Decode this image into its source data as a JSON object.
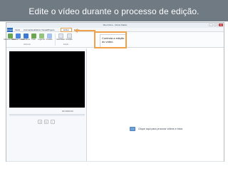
{
  "caption": "Edite o vídeo durante o processo de edição.",
  "window": {
    "title": "Meu Filme - Movie Maker",
    "controls": [
      "–",
      "□",
      "×"
    ]
  },
  "tabs": {
    "file": "Arquivo",
    "items": [
      "Início",
      "Animações",
      "Efeitos Visuais",
      "Projeto",
      "Exibir"
    ],
    "active_label": "Editar"
  },
  "ribbon": {
    "buttons": [
      {
        "label": "Adicionar vídeos",
        "icon": "add-video-icon",
        "color": "#6aa84f"
      },
      {
        "label": "Adicionar música",
        "icon": "add-music-icon",
        "color": "#4a86e8"
      },
      {
        "label": "Instantâneo",
        "icon": "snapshot-icon",
        "color": "#3c78d8"
      },
      {
        "label": "Título",
        "icon": "title-icon",
        "color": "#6aa84f"
      },
      {
        "label": "Legenda",
        "icon": "caption-icon",
        "color": "#93c47d"
      },
      {
        "label": "Créditos",
        "icon": "credits-icon",
        "color": "#a4c2f4"
      }
    ],
    "group_labels": [
      "Adicionar",
      "Edição"
    ],
    "edit_buttons": [
      {
        "label": "Velocidade",
        "icon": "speed-icon"
      },
      {
        "label": "Duração",
        "icon": "duration-icon"
      }
    ]
  },
  "callout": "Controla a edição do vídeo.",
  "player": {
    "time": "00:00/00:00",
    "controls": [
      "prev",
      "play",
      "next"
    ]
  },
  "storyboard": {
    "empty_text": "Clique aqui para procurar vídeos e fotos"
  },
  "colors": {
    "caption_bg": "#6f7a82",
    "highlight": "#f0a14a",
    "file_tab": "#2f6fc1",
    "video_bg": "#000000"
  }
}
